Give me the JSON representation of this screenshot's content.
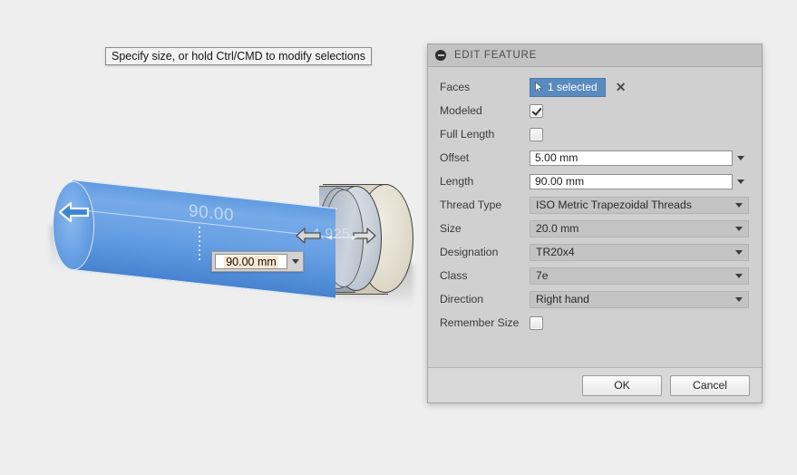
{
  "viewport": {
    "prompt": "Specify size, or hold Ctrl/CMD to modify selections",
    "canvas_dimension_value": "90.00 mm",
    "ghost_length_label": "90.00",
    "ghost_offset_label": "4.925",
    "model_colors": {
      "selected_face": "#6aa2e5",
      "thread_band": "#c2cad4",
      "body": "#ded9ca",
      "background": "#eeeeee"
    }
  },
  "dialog": {
    "title": "EDIT FEATURE",
    "collapse_icon": "minus-circle-icon",
    "rows": [
      {
        "label": "Faces",
        "type": "selection",
        "value": "1 selected",
        "clear": "✕",
        "cursor_icon": "cursor-arrow-icon"
      },
      {
        "label": "Modeled",
        "type": "checkbox",
        "checked": true
      },
      {
        "label": "Full Length",
        "type": "checkbox",
        "checked": false
      },
      {
        "label": "Offset",
        "type": "text",
        "value": "5.00 mm"
      },
      {
        "label": "Length",
        "type": "text",
        "value": "90.00 mm"
      },
      {
        "label": "Thread Type",
        "type": "combo",
        "value": "ISO Metric Trapezoidal Threads"
      },
      {
        "label": "Size",
        "type": "combo",
        "value": "20.0 mm"
      },
      {
        "label": "Designation",
        "type": "combo",
        "value": "TR20x4"
      },
      {
        "label": "Class",
        "type": "combo",
        "value": "7e"
      },
      {
        "label": "Direction",
        "type": "combo",
        "value": "Right hand"
      },
      {
        "label": "Remember Size",
        "type": "checkbox",
        "checked": false
      }
    ],
    "footer": {
      "ok_label": "OK",
      "cancel_label": "Cancel"
    }
  }
}
